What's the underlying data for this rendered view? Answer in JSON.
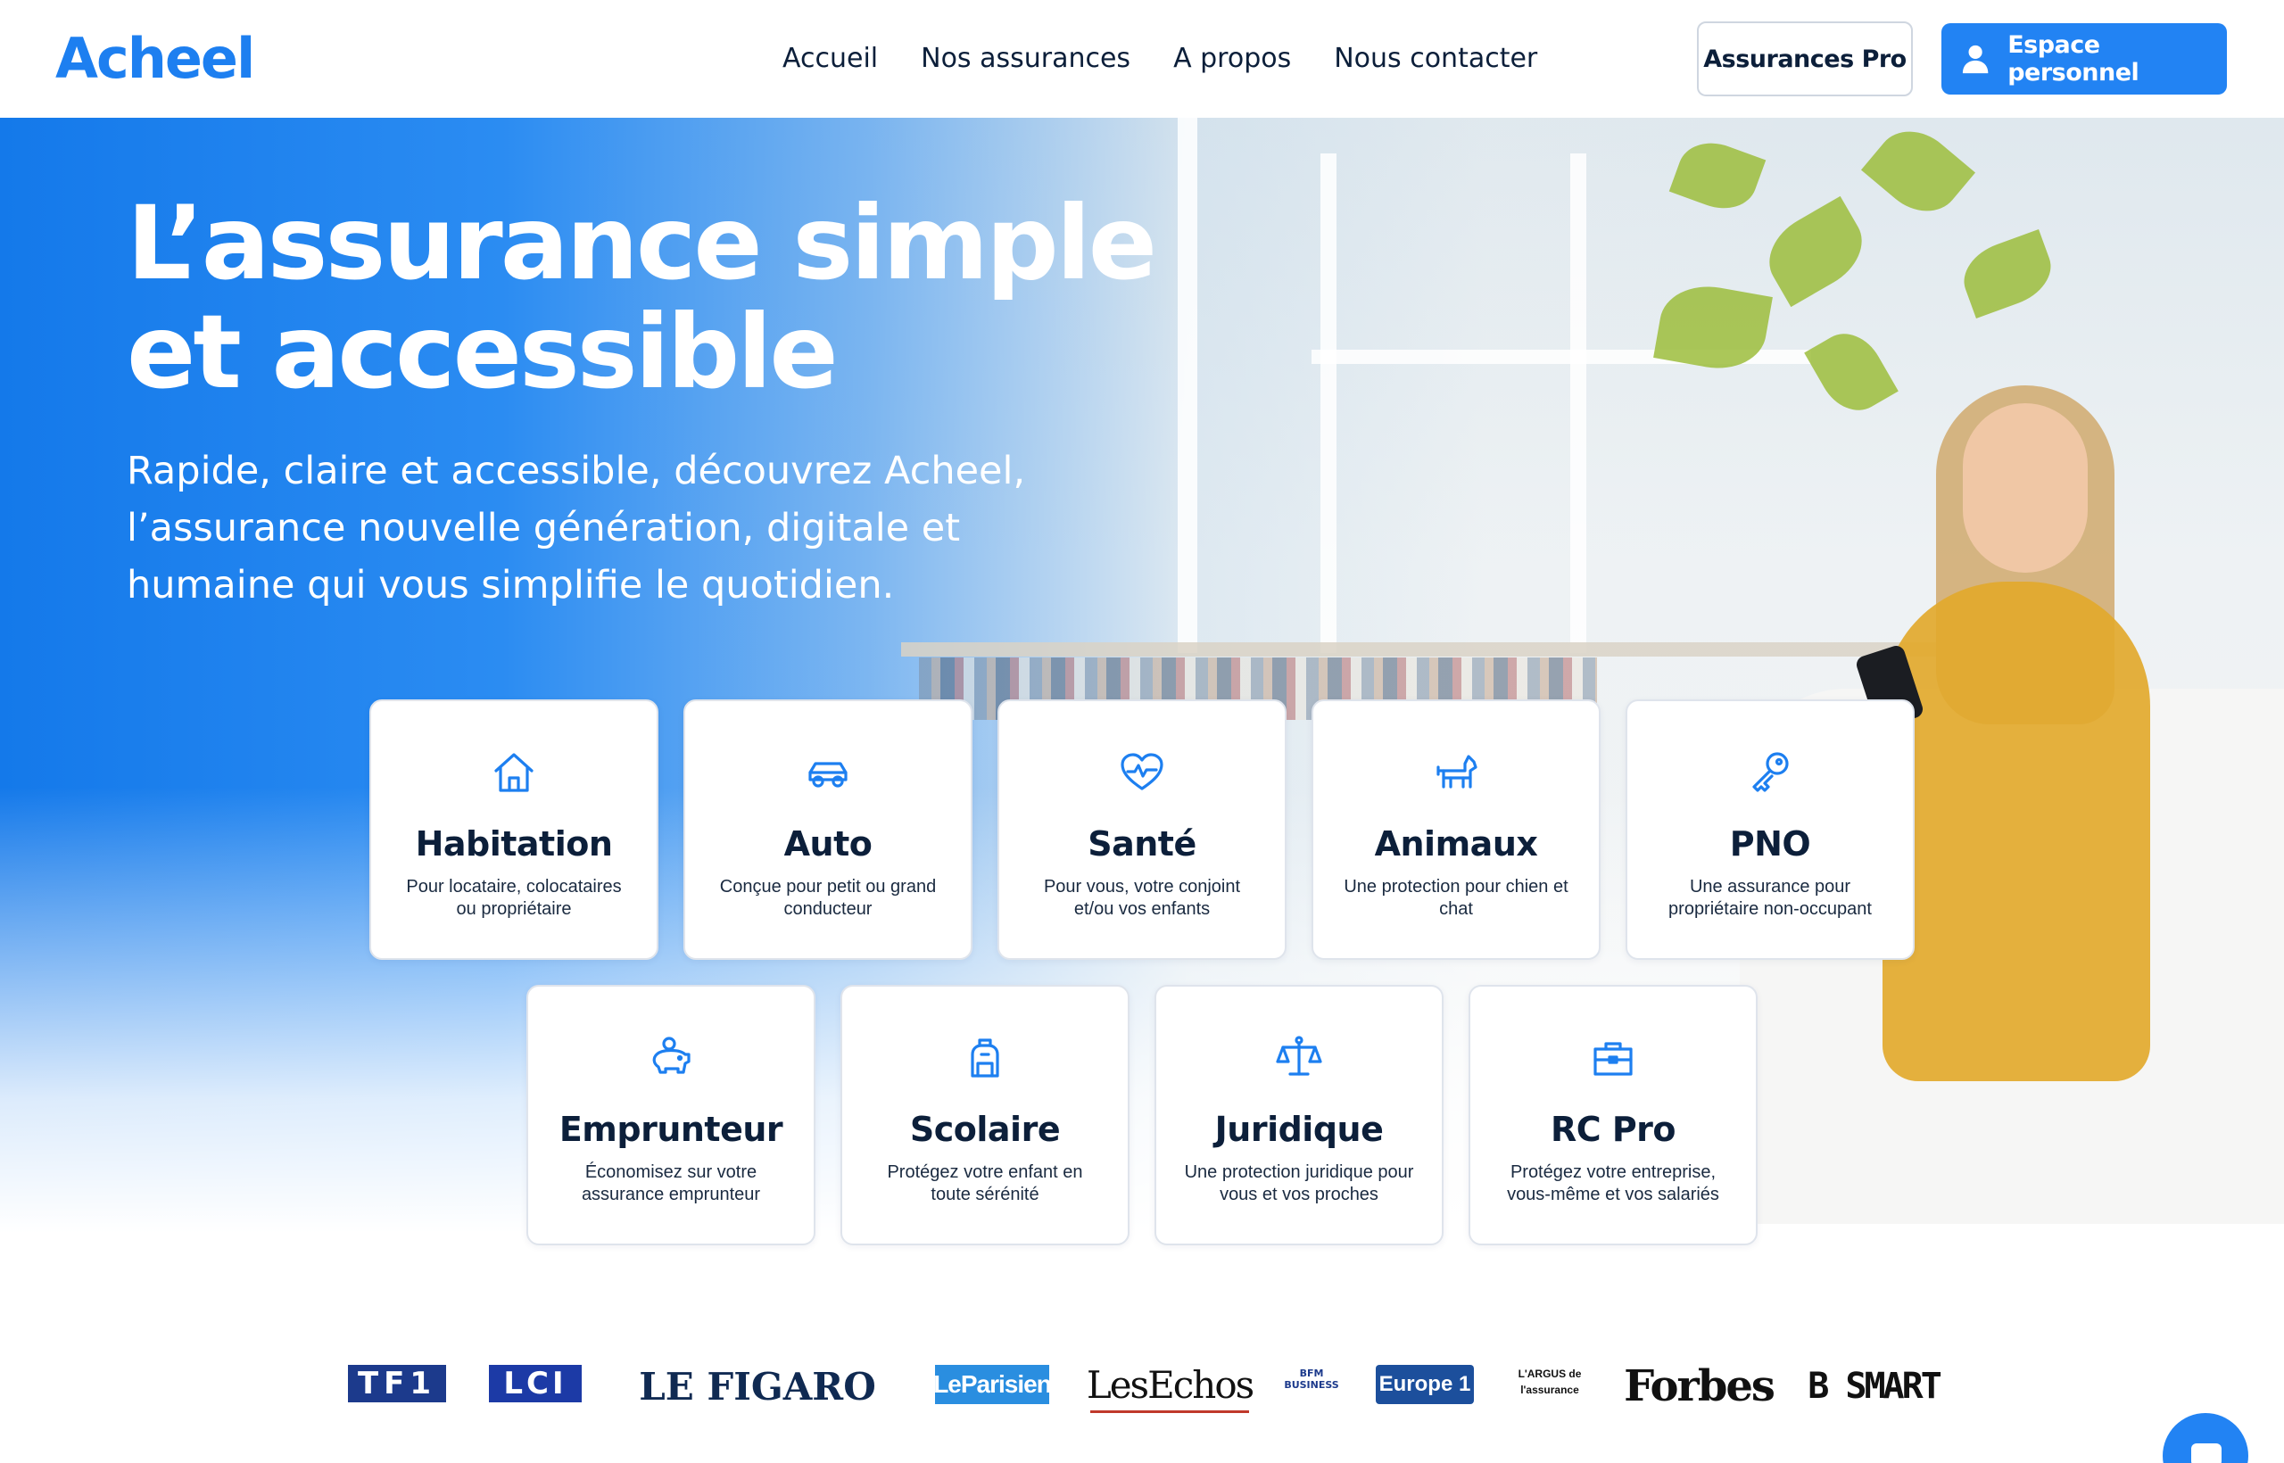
{
  "header": {
    "logo": "Acheel",
    "nav": [
      "Accueil",
      "Nos assurances",
      "A propos",
      "Nous contacter"
    ],
    "pro_button": "Assurances Pro",
    "espace_button": "Espace personnel"
  },
  "hero": {
    "title_line1": "L’assurance simple",
    "title_line2": "et accessible",
    "subtitle": "Rapide, claire et accessible, découvrez Acheel, l’assurance nouvelle génération, digitale et humaine qui vous simplifie le quotidien."
  },
  "cards": [
    {
      "title": "Habitation",
      "desc": "Pour locataire, colocataires ou propriétaire",
      "icon": "house-icon"
    },
    {
      "title": "Auto",
      "desc": "Conçue pour petit ou grand conducteur",
      "icon": "car-icon"
    },
    {
      "title": "Santé",
      "desc": "Pour vous, votre conjoint et/ou vos enfants",
      "icon": "heart-pulse-icon"
    },
    {
      "title": "Animaux",
      "desc": "Une protection pour chien et chat",
      "icon": "dog-icon"
    },
    {
      "title": "PNO",
      "desc": "Une assurance pour propriétaire non-occupant",
      "icon": "key-icon"
    },
    {
      "title": "Emprunteur",
      "desc": "Économisez sur votre assurance emprunteur",
      "icon": "piggy-bank-icon"
    },
    {
      "title": "Scolaire",
      "desc": "Protégez votre enfant en toute sérénité",
      "icon": "backpack-icon"
    },
    {
      "title": "Juridique",
      "desc": "Une protection juridique pour vous et vos proches",
      "icon": "scales-icon"
    },
    {
      "title": "RC Pro",
      "desc": "Protégez votre entreprise, vous-même et vos salariés",
      "icon": "briefcase-icon"
    }
  ],
  "press": [
    "TF1",
    "LCI",
    "LE FIGARO",
    "LeParisien",
    "LesEchos",
    "BFM BUSINESS",
    "Europe 1",
    "L'ARGUS de l'assurance",
    "Forbes",
    "B SMART"
  ],
  "colors": {
    "brand": "#1d7ff0",
    "button": "#2283f3",
    "text": "#0c1f3a"
  }
}
